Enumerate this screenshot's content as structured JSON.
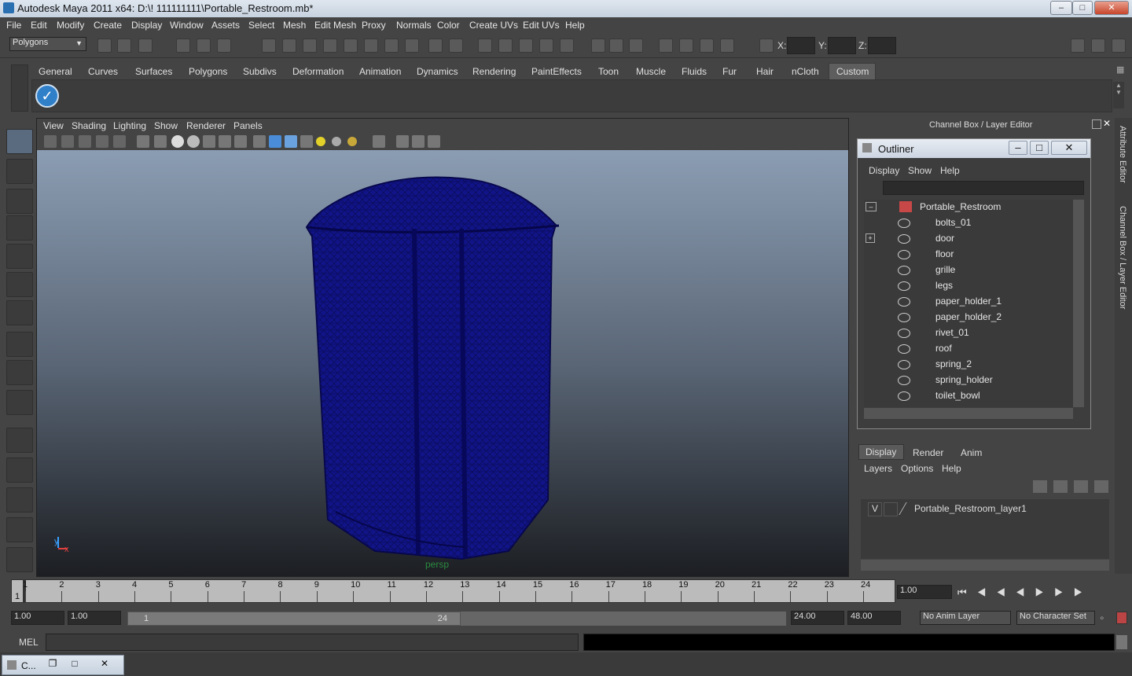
{
  "window": {
    "title": "Autodesk Maya 2011 x64: D:\\! 111111111\\Portable_Restroom.mb*"
  },
  "menubar": [
    "File",
    "Edit",
    "Modify",
    "Create",
    "Display",
    "Window",
    "Assets",
    "Select",
    "Mesh",
    "Edit Mesh",
    "Proxy",
    "Normals",
    "Color",
    "Create UVs",
    "Edit UVs",
    "Help"
  ],
  "status": {
    "mode": "Polygons",
    "x_label": "X:",
    "y_label": "Y:",
    "z_label": "Z:"
  },
  "shelf_tabs": [
    "General",
    "Curves",
    "Surfaces",
    "Polygons",
    "Subdivs",
    "Deformation",
    "Animation",
    "Dynamics",
    "Rendering",
    "PaintEffects",
    "Toon",
    "Muscle",
    "Fluids",
    "Fur",
    "Hair",
    "nCloth",
    "Custom"
  ],
  "shelf_active": "Custom",
  "viewport": {
    "menus": [
      "View",
      "Shading",
      "Lighting",
      "Show",
      "Renderer",
      "Panels"
    ],
    "camera_label": "persp",
    "axis_y": "y",
    "axis_x": "x"
  },
  "right_panel": {
    "title": "Channel Box / Layer Editor"
  },
  "outliner": {
    "title": "Outliner",
    "menus": [
      "Display",
      "Show",
      "Help"
    ],
    "root": "Portable_Restroom",
    "items": [
      "bolts_01",
      "door",
      "floor",
      "grille",
      "legs",
      "paper_holder_1",
      "paper_holder_2",
      "rivet_01",
      "roof",
      "spring_2",
      "spring_holder",
      "toilet_bowl"
    ]
  },
  "layer_editor": {
    "tabs": [
      "Display",
      "Render",
      "Anim"
    ],
    "menus": [
      "Layers",
      "Options",
      "Help"
    ],
    "layer_visibility": "V",
    "layer_name": "Portable_Restroom_layer1"
  },
  "side_tabs": [
    "Attribute Editor",
    "Channel Box / Layer Editor"
  ],
  "timeline": {
    "ticks": [
      "1",
      "2",
      "3",
      "4",
      "5",
      "6",
      "7",
      "8",
      "9",
      "10",
      "11",
      "12",
      "13",
      "14",
      "15",
      "16",
      "17",
      "18",
      "19",
      "20",
      "21",
      "22",
      "23",
      "24"
    ],
    "current_frame_marker": "1",
    "current_time": "1.00"
  },
  "range": {
    "start": "1.00",
    "playback_start": "1.00",
    "slider_start": "1",
    "slider_end": "24",
    "playback_end": "24.00",
    "end": "48.00",
    "anim_layer": "No Anim Layer",
    "char_set": "No Character Set"
  },
  "cmdline": {
    "label": "MEL"
  },
  "taskbar": {
    "item": "C..."
  }
}
